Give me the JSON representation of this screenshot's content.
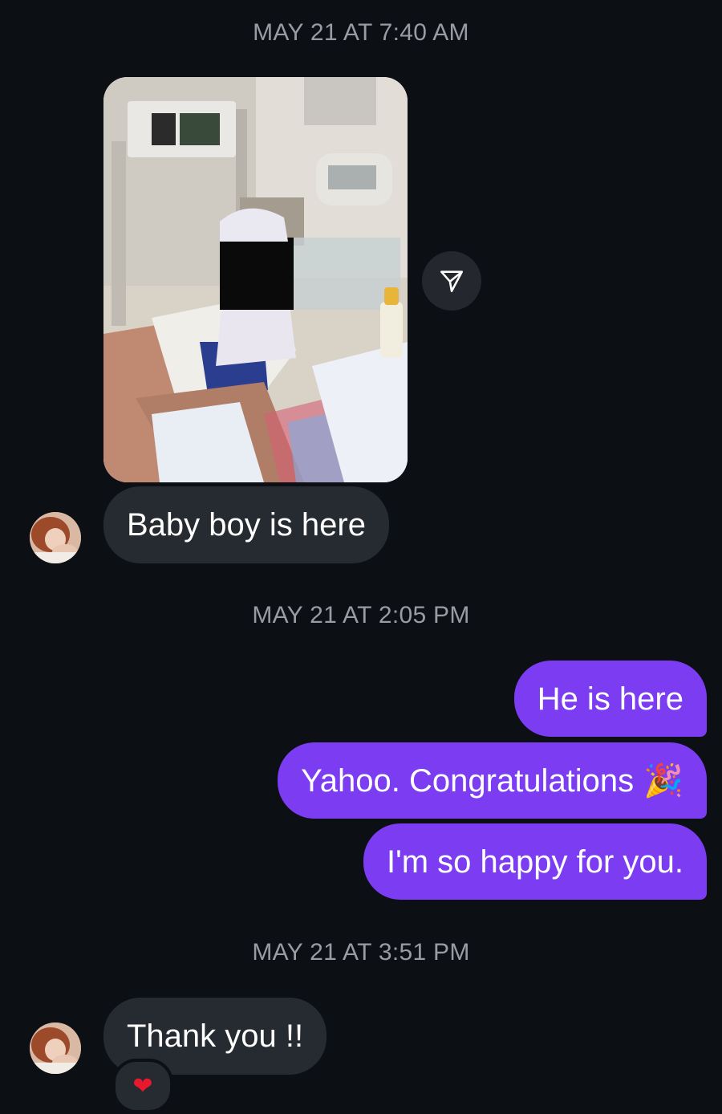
{
  "thread": {
    "timestamp_1": "MAY 21 AT 7:40 AM",
    "timestamp_2": "MAY 21 AT 2:05 PM",
    "timestamp_3": "MAY 21 AT 3:51 PM"
  },
  "messages": {
    "baby_boy": "Baby boy is here",
    "he_is_here": "He is here",
    "yahoo": "Yahoo.  Congratulations",
    "yahoo_emoji": "🎉",
    "happy": "I'm so happy for you.",
    "thanks": "Thank you !!"
  },
  "reactions": {
    "thanks_reaction": "❤"
  },
  "icons": {
    "share": "paper-plane-icon",
    "avatar": "contact-avatar"
  },
  "colors": {
    "background": "#0c0f14",
    "incoming_bubble": "#262a31",
    "outgoing_bubble": "#7c3df2",
    "timestamp": "#9a9ca3"
  }
}
